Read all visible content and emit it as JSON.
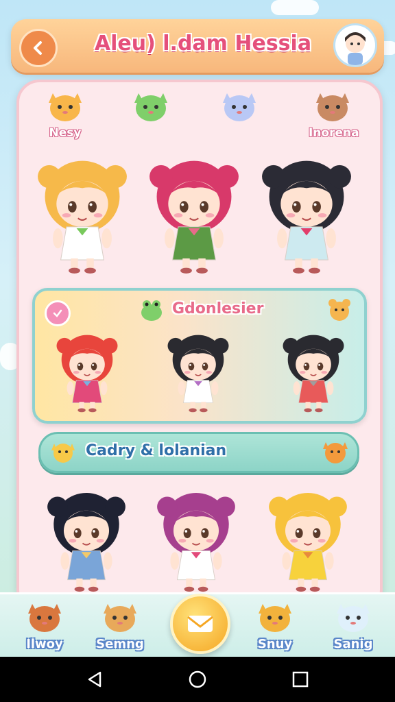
{
  "header": {
    "title": "Aleu) l.dam Hessia",
    "back_icon": "chevron-left-icon"
  },
  "pets_row": [
    {
      "label": "Nesy",
      "icon": "orange-cat-icon",
      "color": "#f8b64a"
    },
    {
      "label": "",
      "icon": "green-frog-icon",
      "color": "#7fcf6a"
    },
    {
      "label": "",
      "icon": "blue-cat-icon",
      "color": "#b9c8f5"
    },
    {
      "label": "Inorena",
      "icon": "girl-avatar-icon",
      "color": "#c98a63"
    }
  ],
  "top_characters": [
    {
      "hair": "#f6b94a",
      "outfit": "#ffffff",
      "accent": "#79c95c"
    },
    {
      "hair": "#d8396a",
      "outfit": "#5c9a45",
      "accent": "#e86b8a"
    },
    {
      "hair": "#2b2b35",
      "outfit": "#cdeaf0",
      "accent": "#e23d6a"
    }
  ],
  "featured": {
    "title": "Gdonlesier",
    "characters": [
      {
        "hair": "#e8453c",
        "outfit": "#e24a7a",
        "accent": "#7ab2e0"
      },
      {
        "hair": "#2a2a30",
        "outfit": "#ffffff",
        "accent": "#b36fc4"
      },
      {
        "hair": "#2a2a30",
        "outfit": "#e85a5a",
        "accent": "#9e9e9e"
      }
    ]
  },
  "category": {
    "label": "Cadry & lolanian"
  },
  "bottom_characters": [
    {
      "hair": "#1f2233",
      "outfit": "#7aa5d8",
      "accent": "#f3c96a"
    },
    {
      "hair": "#a63f8e",
      "outfit": "#ffffff",
      "accent": "#e24a7a"
    },
    {
      "hair": "#f7c23c",
      "outfit": "#f7d23c",
      "accent": "#e88a3c"
    }
  ],
  "bottom_nav": [
    {
      "label": "Ilwoy",
      "icon": "brown-dog-icon"
    },
    {
      "label": "Semng",
      "icon": "tan-bear-icon"
    },
    {
      "label": "Snuy",
      "icon": "orange-bear-icon"
    },
    {
      "label": "Sanig",
      "icon": "white-cat-icon"
    }
  ],
  "center_button": {
    "icon": "envelope-icon"
  },
  "colors": {
    "accent_pink": "#e5507b",
    "header_orange": "#f7b77c",
    "panel_pink": "#fde9ec",
    "teal": "#8dd4c7"
  }
}
